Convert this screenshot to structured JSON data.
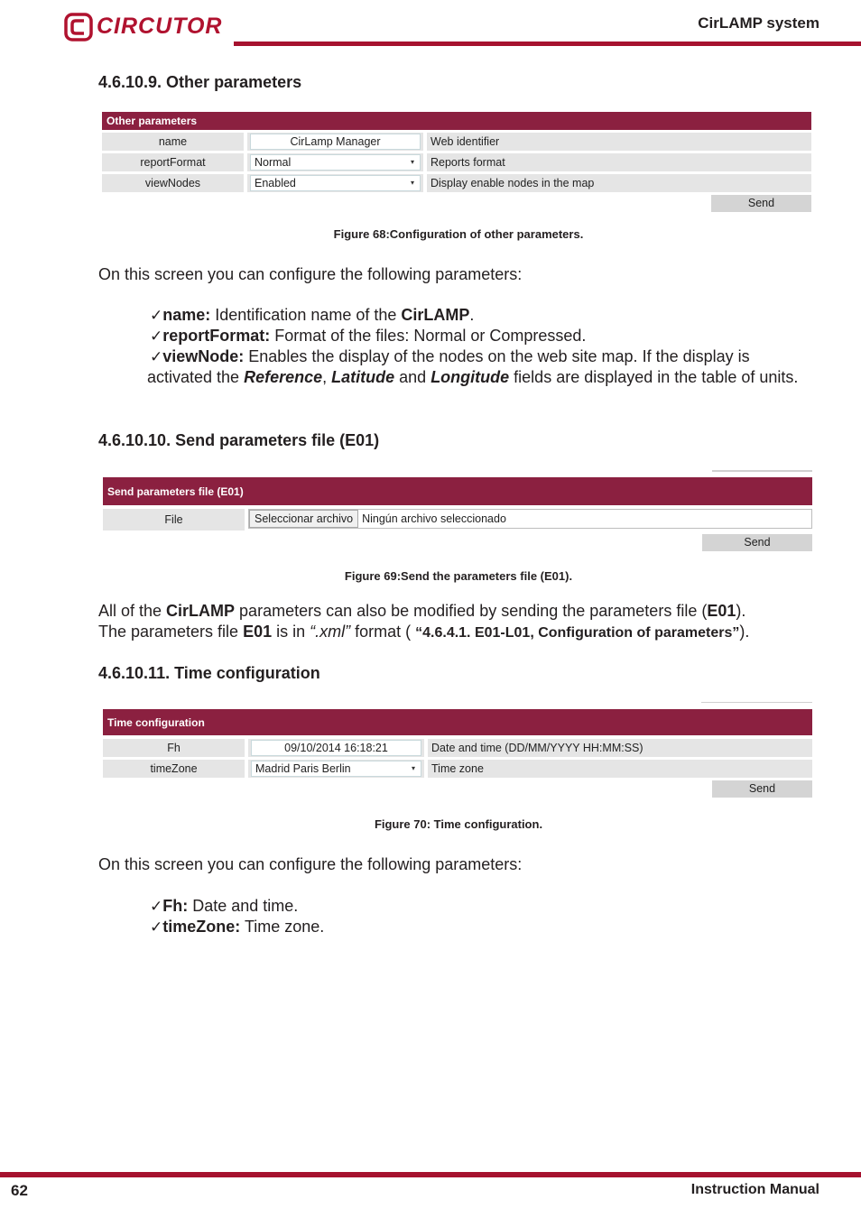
{
  "header": {
    "logo_text": "CIRCUTOR",
    "title": "CirLAMP system",
    "brand_color": "#a6122f"
  },
  "footer": {
    "page_number": "62",
    "title": "Instruction Manual"
  },
  "section1": {
    "heading": "4.6.10.9. Other parameters",
    "panel": {
      "title": "Other parameters",
      "rows": [
        {
          "label": "name",
          "value": "CirLamp Manager",
          "type": "text",
          "description": "Web identifier"
        },
        {
          "label": "reportFormat",
          "value": "Normal",
          "type": "select",
          "description": "Reports format"
        },
        {
          "label": "viewNodes",
          "value": "Enabled",
          "type": "select",
          "description": "Display enable nodes in the map"
        }
      ],
      "send_label": "Send",
      "header_color": "#8b2040"
    },
    "caption": "Figure 68:Configuration of other parameters.",
    "intro": "On this screen you can configure the following parameters:",
    "items": [
      {
        "check": "✓",
        "term": "name:",
        "text_a": " Identification name of the ",
        "bold": "CirLAMP",
        "text_b": "."
      },
      {
        "check": "✓",
        "term": "reportFormat:",
        "text_a": " Format of the files: Normal or Compressed."
      },
      {
        "check": "✓",
        "term": "viewNode:",
        "text_a": " Enables the display of the nodes on the web site map. If the display is activated the ",
        "em1": "Reference",
        "sep1": ", ",
        "em2": "Latitude",
        "sep2": " and ",
        "em3": "Longitude",
        "text_b": " fields are displayed in the table of units."
      }
    ]
  },
  "section2": {
    "heading": "4.6.10.10. Send parameters file (E01)",
    "panel": {
      "title": "Send parameters file (E01)",
      "file_label": "File",
      "choose_button": "Seleccionar archivo",
      "no_file_text": "Ningún archivo seleccionado",
      "send_label": "Send"
    },
    "caption": "Figure 69:Send the parameters file (E01).",
    "para": {
      "p1": "All of the ",
      "b1": "CirLAMP",
      "p2": " parameters can also be modified by sending the parameters file (",
      "b2": "E01",
      "p3": ").",
      "p4": "The parameters file ",
      "b3": "E01",
      "p5": " is in ",
      "i1": "“.xml”",
      "p6": " format ( ",
      "b4": "“4.6.4.1. E01-L01, Configuration of parameters”",
      "p7": ")."
    }
  },
  "section3": {
    "heading": "4.6.10.11. Time configuration",
    "panel": {
      "title": "Time configuration",
      "rows": [
        {
          "label": "Fh",
          "value": "09/10/2014 16:18:21",
          "type": "text",
          "description": "Date and time (DD/MM/YYYY HH:MM:SS)"
        },
        {
          "label": "timeZone",
          "value": "Madrid Paris Berlin",
          "type": "select",
          "description": "Time zone"
        }
      ],
      "send_label": "Send"
    },
    "caption": "Figure 70: Time configuration.",
    "intro": "On this screen you can configure the following parameters:",
    "items": [
      {
        "check": "✓",
        "term": "Fh:",
        "text": " Date and time."
      },
      {
        "check": "✓",
        "term": "timeZone:",
        "text": " Time zone."
      }
    ]
  },
  "icons": {
    "select_arrow": "▾"
  }
}
